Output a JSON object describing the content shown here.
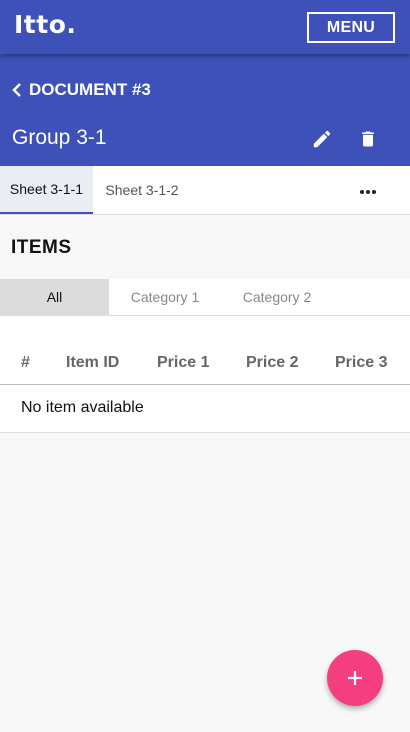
{
  "app": {
    "logo": "Itto.",
    "menu_label": "MENU"
  },
  "document": {
    "back_label": "DOCUMENT #3",
    "group_title": "Group 3-1",
    "actions": {
      "edit_icon": "pencil-icon",
      "delete_icon": "trash-icon"
    }
  },
  "sheet_tabs": {
    "items": [
      {
        "label": "Sheet 3-1-1",
        "active": true
      },
      {
        "label": "Sheet 3-1-2",
        "active": false
      }
    ],
    "more_icon": "more-horizontal-icon"
  },
  "items_section": {
    "title": "ITEMS",
    "categories": [
      {
        "label": "All",
        "active": true
      },
      {
        "label": "Category 1",
        "active": false
      },
      {
        "label": "Category 2",
        "active": false
      }
    ],
    "table": {
      "columns": [
        "#",
        "Item ID",
        "Price 1",
        "Price 2",
        "Price 3"
      ],
      "empty_text": "No item available"
    }
  },
  "fab": {
    "icon": "plus-icon"
  },
  "colors": {
    "primary": "#3d51b9",
    "accent": "#f53e7f"
  }
}
